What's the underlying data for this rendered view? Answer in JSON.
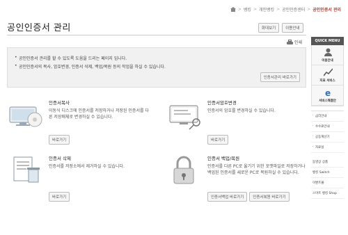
{
  "breadcrumb": [
    "뱅킹",
    "개인뱅킹",
    "공인인증센터",
    "공인인증서 관리"
  ],
  "page_title": "공인인증서 관리",
  "title_buttons": {
    "zoom": "화대보기",
    "guide": "이용안내"
  },
  "print_label": "인쇄",
  "info": {
    "lines": [
      "공인인증서 관리를 할 수 있도록 도움을 드리는 페이지 입니다.",
      "공인인증서의 복사, 암호변경, 인증서 삭제, 백업/복원 등의 작업을 하실 수 있습니다."
    ],
    "button": "인증서관리 바로가기"
  },
  "cards": [
    {
      "title": "인증서복사",
      "desc": "이동식 디스크에 인증서를 저장하거나 저장된 인증서를 다른 저장매체로 변경하실 수 있습니다.",
      "buttons": [
        "바로가기"
      ]
    },
    {
      "title": "인증서암호변경",
      "desc": "인증서의 암호를 변경하실 수 있습니다.",
      "buttons": [
        "바로가기"
      ]
    },
    {
      "title": "인증서 삭제",
      "desc": "인증서를 저장소에서 제거하실 수 있습니다.",
      "buttons": [
        "바로가기"
      ]
    },
    {
      "title": "인증서 백업/복원",
      "desc": "인증서를 다른 PC로 옮기기 위한 포맷파일로 저장하거나 백업된 인증서를 새로운 PC로 복원하실 수 있습니다.",
      "buttons": [
        "인증서백업 바로가기",
        "인증서복원 바로가기"
      ]
    }
  ],
  "quick_menu": {
    "title": "QUICK MENU",
    "items": [
      "이용안내",
      "지표 서비스",
      "서비스해결안"
    ],
    "links": [
      "금리안내",
      "수수료안내",
      "공동계산기",
      "자료실"
    ],
    "extras": [
      "동영상 상품",
      "뱅킹 Switch",
      "이벤트몰",
      "스마트 뱅킹 Shop"
    ]
  },
  "colors": {
    "accent": "#c0392b",
    "info_bg": "#f1f1f1",
    "quick_head": "#555555"
  }
}
